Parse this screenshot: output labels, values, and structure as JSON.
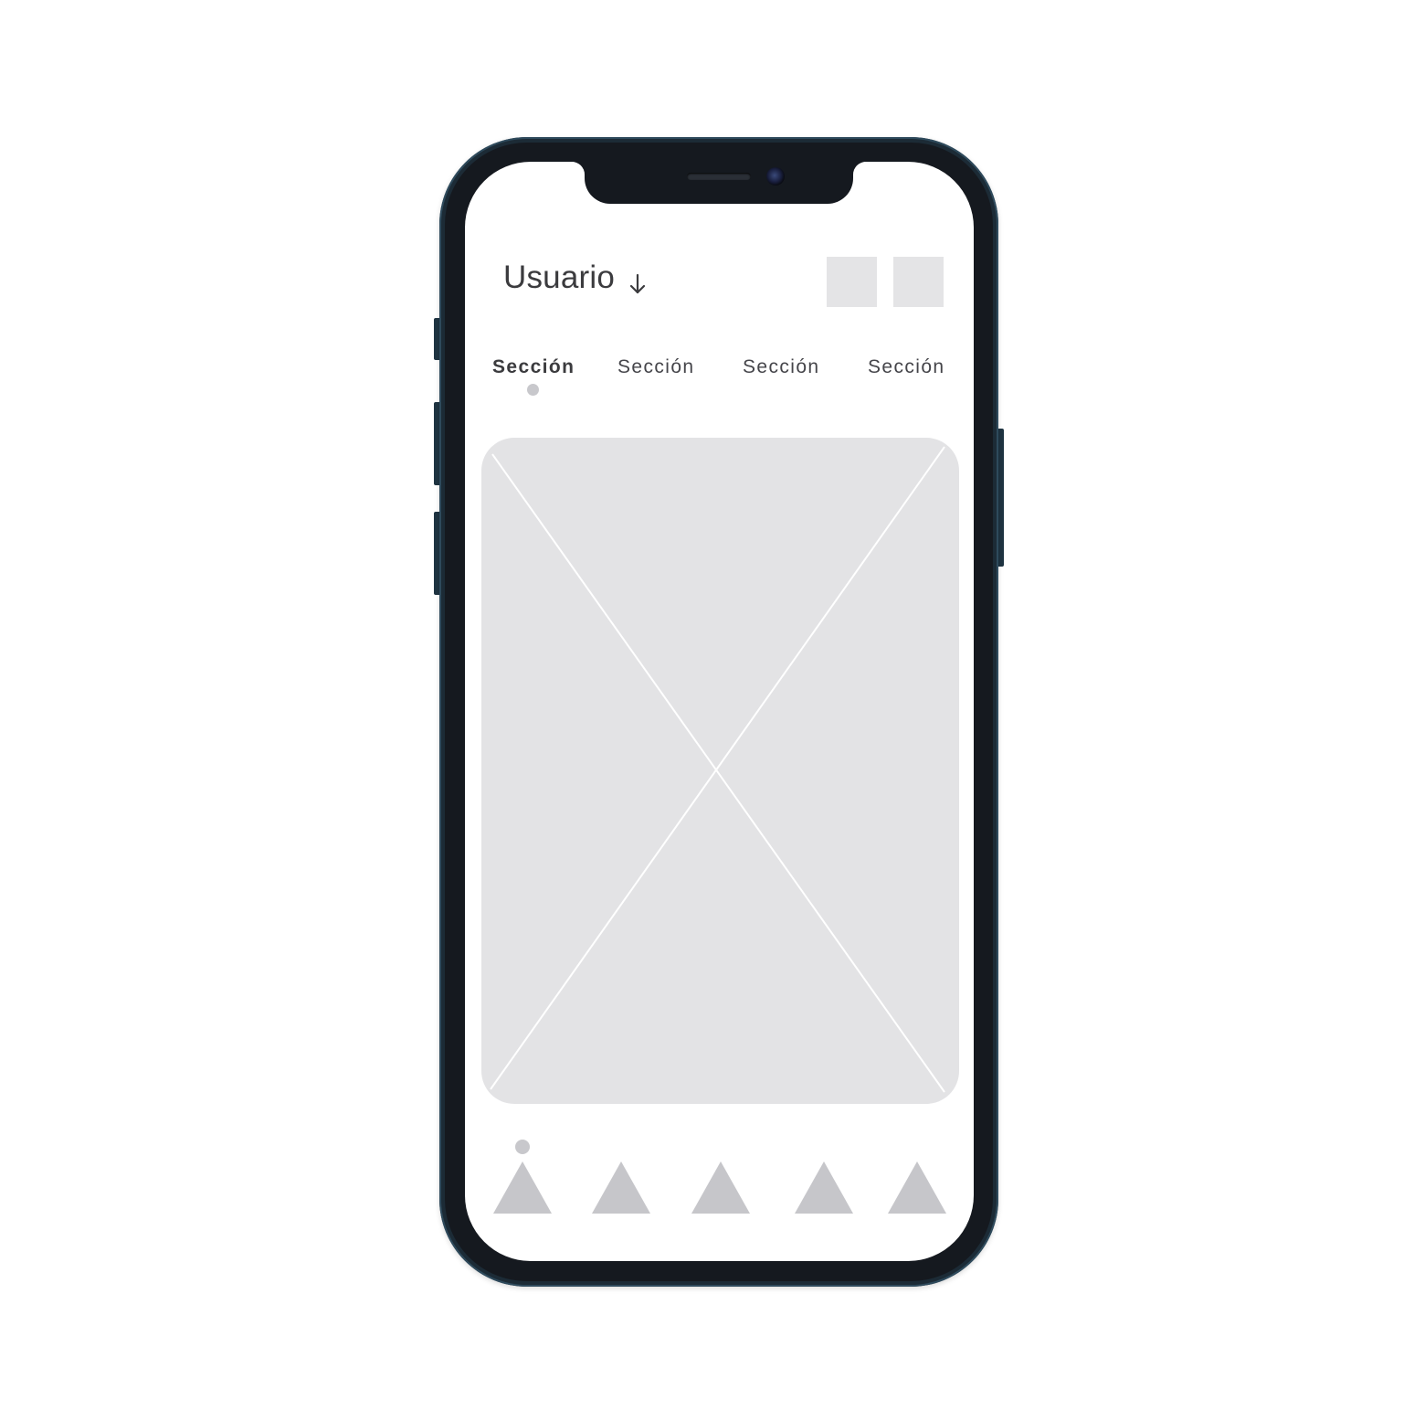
{
  "header": {
    "user_label": "Usuario",
    "dropdown_icon": "arrow-down-icon",
    "action_buttons": [
      "placeholder-square",
      "placeholder-square"
    ]
  },
  "tabs": [
    {
      "label": "Sección",
      "active": true
    },
    {
      "label": "Sección",
      "active": false
    },
    {
      "label": "Sección",
      "active": false
    },
    {
      "label": "Sección",
      "active": false
    }
  ],
  "content": {
    "image_placeholder": "image-placeholder-icon"
  },
  "bottom_nav": {
    "active_index": 0,
    "items": [
      "triangle-icon",
      "triangle-icon",
      "triangle-icon",
      "triangle-icon",
      "triangle-icon"
    ]
  },
  "colors": {
    "placeholder": "#e3e3e5",
    "muted_shape": "#c6c6ca",
    "text": "#3b3b3e",
    "phone_frame": "#1c2b36"
  }
}
